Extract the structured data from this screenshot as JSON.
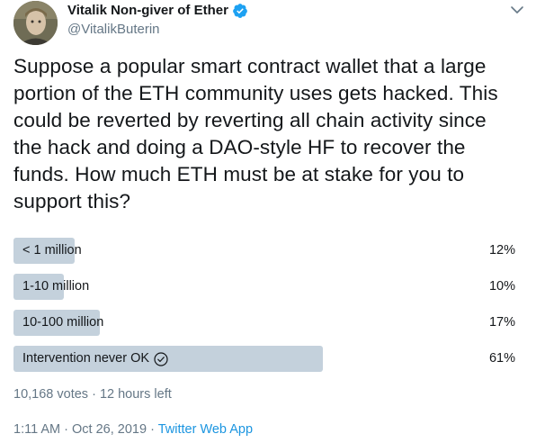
{
  "author": {
    "display_name": "Vitalik Non-giver of Ether",
    "handle": "@VitalikButerin",
    "verified": true
  },
  "tweet": {
    "text": "Suppose a popular smart contract wallet that a large portion of the ETH community uses gets hacked. This could be reverted by reverting all chain activity since the hack and doing a DAO-style HF to recover the funds. How much ETH must be at stake for you to support this?"
  },
  "poll": {
    "options": [
      {
        "label": "< 1 million",
        "percent": "12%",
        "share": 0.12,
        "selected": false
      },
      {
        "label": "1-10 million",
        "percent": "10%",
        "share": 0.1,
        "selected": false
      },
      {
        "label": "10-100 million",
        "percent": "17%",
        "share": 0.17,
        "selected": false
      },
      {
        "label": "Intervention never OK",
        "percent": "61%",
        "share": 0.61,
        "selected": true
      }
    ],
    "votes": "10,168 votes",
    "separator": "·",
    "time_left": "12 hours left"
  },
  "meta": {
    "time": "1:11 AM",
    "separator": "·",
    "date": "Oct 26, 2019",
    "source": "Twitter Web App"
  },
  "colors": {
    "bar": "#c4d1dc",
    "link": "#1b95e0",
    "muted": "#657786",
    "verified": "#1da1f2"
  }
}
